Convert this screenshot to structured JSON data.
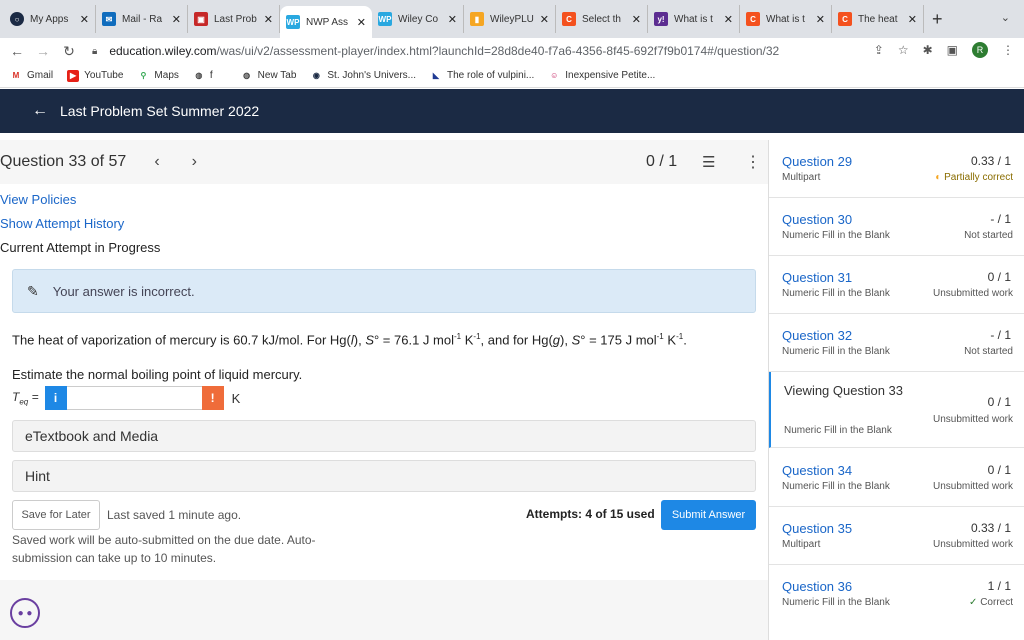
{
  "tabs": [
    {
      "title": "My Apps",
      "icon": "ring-icon",
      "color": "#1b2a44"
    },
    {
      "title": "Mail - Ra",
      "icon": "mail-icon",
      "color": "#0f6cbd"
    },
    {
      "title": "Last Prob",
      "icon": "app-icon",
      "color": "#c62828"
    },
    {
      "title": "NWP Ass",
      "icon": "wp-icon",
      "color": "#29a8e0"
    },
    {
      "title": "Wiley Co",
      "icon": "wp-icon",
      "color": "#29a8e0"
    },
    {
      "title": "WileyPLU",
      "icon": "wiley-icon",
      "color": "#f5a623"
    },
    {
      "title": "Select th",
      "icon": "c-icon",
      "color": "#f4511e"
    },
    {
      "title": "What is t",
      "icon": "y-icon",
      "color": "#5c2d91"
    },
    {
      "title": "What is t",
      "icon": "c-icon",
      "color": "#f4511e"
    },
    {
      "title": "The heat",
      "icon": "c-icon",
      "color": "#f4511e"
    }
  ],
  "new_tab_label": "+",
  "address": {
    "host": "education.wiley.com",
    "path": "/was/ui/v2/assessment-player/index.html?launchId=28d8de40-f7a6-4356-8f45-692f7f9b0174#/question/32",
    "avatar_letter": "R"
  },
  "bookmarks": [
    {
      "label": "Gmail",
      "icon": "gmail-icon"
    },
    {
      "label": "YouTube",
      "icon": "youtube-icon"
    },
    {
      "label": "Maps",
      "icon": "maps-icon"
    },
    {
      "label": "f",
      "icon": "globe-icon"
    },
    {
      "label": "New Tab",
      "icon": "globe-icon"
    },
    {
      "label": "St. John's Univers...",
      "icon": "ring-icon"
    },
    {
      "label": "The role of vulpini...",
      "icon": "triangle-icon"
    },
    {
      "label": "Inexpensive Petite...",
      "icon": "face-icon"
    }
  ],
  "header": {
    "title": "Last Problem Set Summer 2022"
  },
  "question_bar": {
    "title": "Question 33 of 57",
    "score": "0 / 1"
  },
  "links": {
    "view_policies": "View Policies",
    "attempt_history": "Show Attempt History"
  },
  "current_attempt": "Current Attempt in Progress",
  "feedback": "Your answer is incorrect.",
  "question": {
    "p1": "The heat of vaporization of mercury is 60.7 kJ/mol. For Hg(",
    "l": "l",
    "p2": "), ",
    "s1": "S",
    "p3": "° = 76.1 J mol",
    "neg1": "-1",
    "p4": " K",
    "neg2": "-1",
    "p5": ", and for Hg(",
    "g": "g",
    "p6": "), ",
    "s2": "S",
    "p7": "° = 175 J mol",
    "neg3": "-1",
    "p8": " K",
    "neg4": "-1",
    "p9": ".",
    "estimate": "Estimate the normal boiling point of liquid mercury.",
    "teq_label": "T",
    "teq_sub": "eq",
    "teq_eq": " =",
    "answer_value": "",
    "unit": "K"
  },
  "panels": {
    "etextbook": "eTextbook and Media",
    "hint": "Hint"
  },
  "footer": {
    "save_later": "Save for Later",
    "last_saved": "Last saved 1 minute ago.",
    "attempts": "Attempts: 4 of 15 used",
    "submit": "Submit Answer",
    "note": "Saved work will be auto-submitted on the due date. Auto-submission can take up to 10 minutes."
  },
  "sidebar": [
    {
      "name": "Question 29",
      "type": "Multipart",
      "score": "0.33 / 1",
      "status": "Partially correct",
      "status_icon": "half-circle-icon"
    },
    {
      "name": "Question 30",
      "type": "Numeric Fill in the Blank",
      "score": "- / 1",
      "status": "Not started"
    },
    {
      "name": "Question 31",
      "type": "Numeric Fill in the Blank",
      "score": "0 / 1",
      "status": "Unsubmitted work"
    },
    {
      "name": "Question 32",
      "type": "Numeric Fill in the Blank",
      "score": "- / 1",
      "status": "Not started"
    },
    {
      "name": "Viewing Question 33",
      "type": "Numeric Fill in the Blank",
      "score": "0 / 1",
      "status": "Unsubmitted work"
    },
    {
      "name": "Question 34",
      "type": "Numeric Fill in the Blank",
      "score": "0 / 1",
      "status": "Unsubmitted work"
    },
    {
      "name": "Question 35",
      "type": "Multipart",
      "score": "0.33 / 1",
      "status": "Unsubmitted work"
    },
    {
      "name": "Question 36",
      "type": "Numeric Fill in the Blank",
      "score": "1 / 1",
      "status": "Correct",
      "status_icon": "check-icon"
    }
  ]
}
